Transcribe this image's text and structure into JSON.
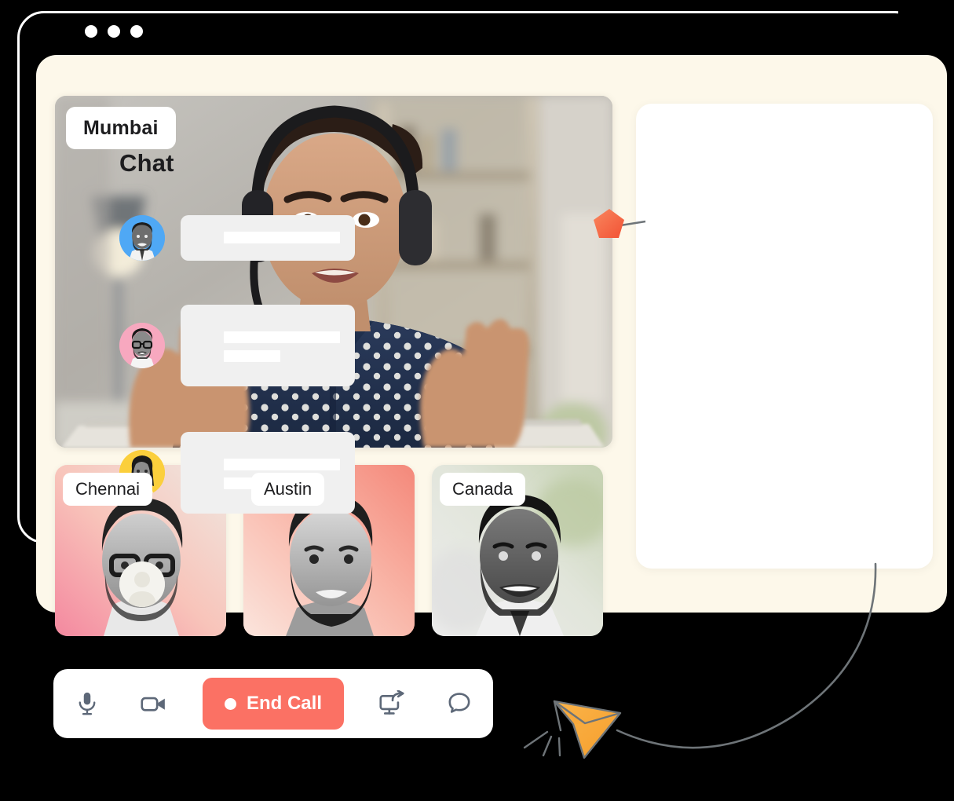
{
  "window": {
    "dots": [
      "dot-1",
      "dot-2",
      "dot-3"
    ]
  },
  "main_video": {
    "label": "Mumbai",
    "description": "woman-with-headset-video-feed"
  },
  "thumbnails": [
    {
      "label": "Chennai",
      "accent": "#F4889F"
    },
    {
      "label": "Austin",
      "accent": "#F58F80"
    },
    {
      "label": "Canada",
      "accent": "#CDD6BD"
    }
  ],
  "chat": {
    "title": "Chat",
    "messages": [
      {
        "avatar_color": "#4FA8F5",
        "lines": 1
      },
      {
        "avatar_color": "#F7A8BF",
        "lines": 2
      },
      {
        "avatar_color": "#FBCF3C",
        "lines": 2
      },
      {
        "avatar_color": "#F4F3EE",
        "lines": 0
      }
    ]
  },
  "toolbar": {
    "mic_label": "Microphone",
    "video_label": "Camera",
    "end_call_label": "End Call",
    "share_label": "Share screen",
    "chat_label": "Chat"
  },
  "colors": {
    "background": "#000000",
    "panel": "#FDF8EA",
    "card": "#FFFFFF",
    "end_call": "#FB7164",
    "bubble": "#F0F0F0",
    "icon": "#5D6878",
    "marker": "#F4714E",
    "plane": "#F9A93B",
    "line": "#6E7478"
  },
  "decorations": {
    "marker": "pentagon-marker",
    "plane": "paper-plane",
    "trail": "curved-trail-line"
  }
}
